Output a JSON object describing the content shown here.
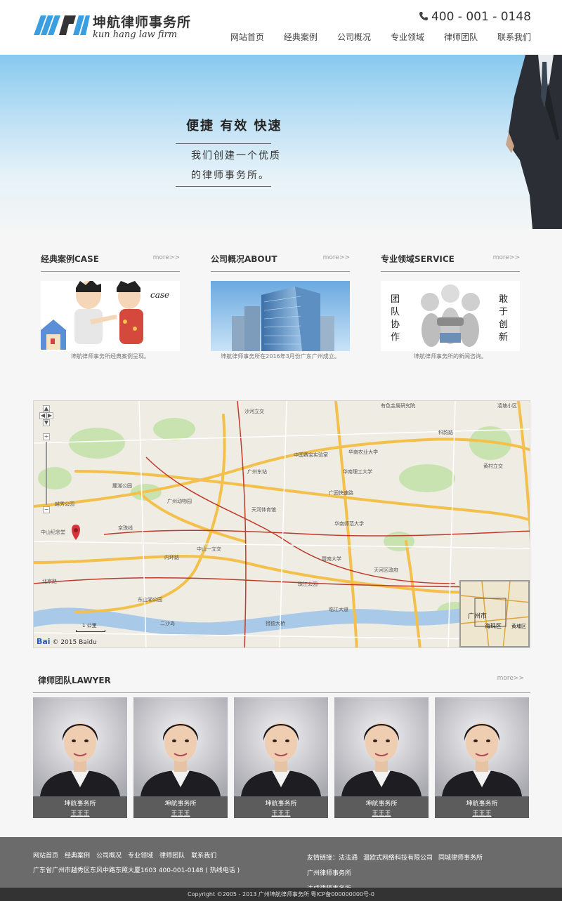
{
  "header": {
    "logo_cn": "坤航律师事务所",
    "logo_en": "kun hang law firm",
    "phone": "400 - 001 - 0148",
    "nav": [
      "网站首页",
      "经典案例",
      "公司概况",
      "专业领域",
      "律师团队",
      "联系我们"
    ]
  },
  "banner": {
    "slogan": "便捷  有效   快速",
    "line1": "我们创建一个优质",
    "line2": "的律师事务所。"
  },
  "sections": [
    {
      "title": "经典案例CASE",
      "more": "more>>",
      "caption": "坤航律师事务所经典案例呈现。",
      "image_text": "case"
    },
    {
      "title": "公司概况ABOUT",
      "more": "more>>",
      "caption": "坤航律师事务所在2016年3月份广东广州成立。"
    },
    {
      "title": "专业领域SERVICE",
      "more": "more>>",
      "caption": "坤航律师事务所的新闻咨询。",
      "image_text_left": "团队协作",
      "image_text_right": "敢于创新"
    }
  ],
  "map": {
    "labels": [
      "沙河立交",
      "天河体育馆",
      "中山一立交",
      "内环路",
      "广园快速路",
      "华南理工大学",
      "华南师范大学",
      "广州东站",
      "暨南大学",
      "天河区政府",
      "珠江公园",
      "临江大道",
      "猎德大桥",
      "京珠线",
      "黄村立交",
      "东山湖公园",
      "麓湖公园",
      "广州动物园",
      "越秀公园",
      "中山纪念堂",
      "北京路",
      "二沙岛",
      "华南农业大学",
      "中国赛宝实验室",
      "有色金属研究院",
      "凌塘小区",
      "科韵路",
      "广州市",
      "海珠区",
      "黄埔区"
    ],
    "copyright": "© 2015 Baidu",
    "brand": "Bai",
    "scale": "1 公里"
  },
  "lawyers": {
    "title": "律师团队LAWYER",
    "more": "more>>",
    "cards": [
      {
        "org": "坤航事务所",
        "name": "王王王"
      },
      {
        "org": "坤航事务所",
        "name": "王王王"
      },
      {
        "org": "坤航事务所",
        "name": "王王王"
      },
      {
        "org": "坤航事务所",
        "name": "王王王"
      },
      {
        "org": "坤航事务所",
        "name": "王王王"
      }
    ]
  },
  "footer": {
    "nav": [
      "网站首页",
      "经典案例",
      "公司概况",
      "专业领域",
      "律师团队",
      "联系我们"
    ],
    "address": "广东省广州市越秀区东风中路东照大厦1603    400-001-0148 ( 热线电话 )",
    "friends_label": "友情链接：",
    "friends": [
      "法法通",
      "温欧式网络科技有限公司",
      "同城律师事务所",
      "广州律师事务所",
      "达成律师事务所"
    ],
    "copyright": "Copyright ©2005 - 2013 广州坤航律师事务所 粤ICP备000000000号-0"
  },
  "colors": {
    "logo_blue": "#3a9ee0",
    "banner_top": "#87c9ee",
    "footer_bg": "#6b6b6b",
    "copyright_bg": "#333333"
  }
}
